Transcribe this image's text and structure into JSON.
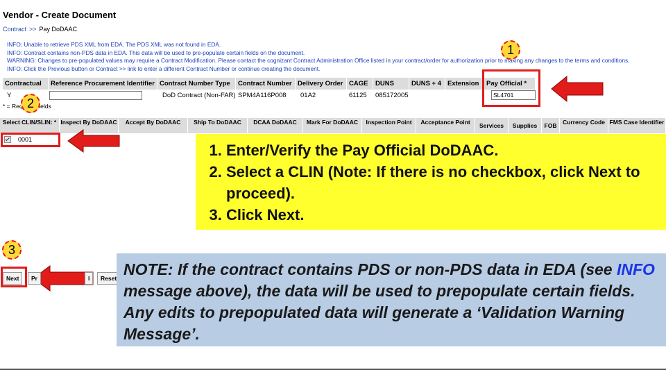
{
  "page": {
    "title": "Vendor - Create Document"
  },
  "breadcrumb": {
    "link": "Contract",
    "separator": ">>",
    "current": "Pay DoDAAC"
  },
  "messages": [
    "INFO: Unable to retrieve PDS XML from EDA. The PDS XML was not found in EDA.",
    "INFO: Contract contains non-PDS data in EDA. This data will be used to pre-populate certain fields on the document.",
    "WARNING: Changes to pre-populated values may require a Contract Modification. Please contact the cognizant Contract Administration Office listed in your contract/order for authorization prior to making any changes to the terms and conditions.",
    "INFO: Click the Previous button or Contract >> link to enter a different Contract Number or continue creating the document."
  ],
  "contract_table": {
    "headers": [
      "Contractual",
      "Reference Procurement Identifier",
      "Contract Number Type",
      "Contract Number",
      "Delivery Order",
      "CAGE",
      "DUNS",
      "DUNS + 4",
      "Extension",
      "Pay Official *"
    ],
    "values": {
      "contractual": "Y",
      "reference_procurement_identifier": "",
      "contract_number_type": "DoD Contract (Non-FAR)",
      "contract_number": "SPM4A116P008",
      "delivery_order": "01A2",
      "cage": "61125",
      "duns": "085172005",
      "duns_plus_4": "",
      "extension": "",
      "pay_official": "SL4701"
    }
  },
  "required_note": "* = Required fields",
  "clin_table": {
    "headers": [
      "Select CLIN/SLIN: *",
      "Inspect By DoDAAC",
      "Accept By DoDAAC",
      "Ship To DoDAAC",
      "DCAA DoDAAC",
      "Mark For DoDAAC",
      "Inspection Point",
      "Acceptance Point",
      "Services",
      "Supplies",
      "FOB",
      "Currency Code",
      "FMS Case Identifier"
    ],
    "rows": [
      {
        "checked": true,
        "clin": "0001"
      }
    ]
  },
  "callout_steps": [
    "Enter/Verify the Pay Official DoDAAC.",
    "Select a CLIN (Note: If there is no checkbox, click Next to proceed).",
    "Click Next."
  ],
  "badges": [
    "1",
    "2",
    "3"
  ],
  "buttons": {
    "next": "Next",
    "previous": "Pr",
    "cancel": "l",
    "reset": "Reset"
  },
  "note": {
    "before": "NOTE: If the contract contains PDS or non-PDS data in EDA (see ",
    "highlight": "INFO",
    "after": " message above), the data will be used to prepopulate certain fields. Any edits to prepopulated data will generate a ‘Validation Warning Message’."
  },
  "colors": {
    "callout_red": "#e21b1b",
    "callout_yellow": "#ffff2e",
    "note_blue": "#b8cce4",
    "info_text": "#1a3fb8"
  }
}
